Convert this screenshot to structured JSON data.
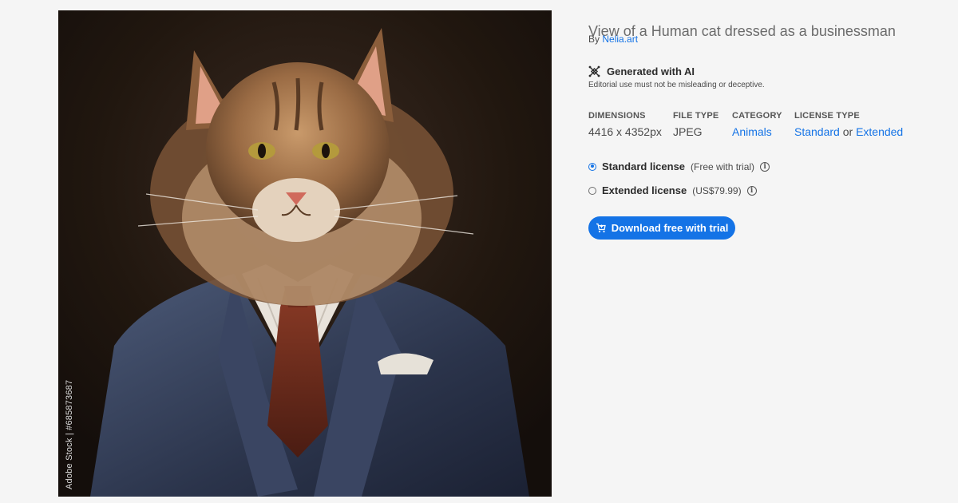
{
  "asset": {
    "title": "View of a Human cat dressed as a businessman",
    "by_prefix": "By",
    "author": "Nelia.art",
    "image_alt": "Cat dressed in a business suit",
    "watermark": "Adobe Stock",
    "vertical_caption": "Adobe Stock | #685873687"
  },
  "ai": {
    "icon": "ai-sparkle-icon",
    "label": "Generated with AI",
    "note": "Editorial use must not be misleading or deceptive."
  },
  "meta": {
    "dimensions_label": "DIMENSIONS",
    "dimensions_value": "4416 x 4352px",
    "filetype_label": "FILE TYPE",
    "filetype_value": "JPEG",
    "category_label": "CATEGORY",
    "category_value": "Animals",
    "license_type_label": "LICENSE TYPE",
    "license_standard": "Standard",
    "license_or": "or",
    "license_extended": "Extended"
  },
  "licenses": [
    {
      "name": "Standard license",
      "price": "(Free with trial)",
      "selected": true
    },
    {
      "name": "Extended license",
      "price": "(US$79.99)",
      "selected": false
    }
  ],
  "download": {
    "label": "Download free with trial",
    "icon": "cart-icon"
  },
  "colors": {
    "accent": "#1473e6",
    "background": "#f5f5f5"
  }
}
